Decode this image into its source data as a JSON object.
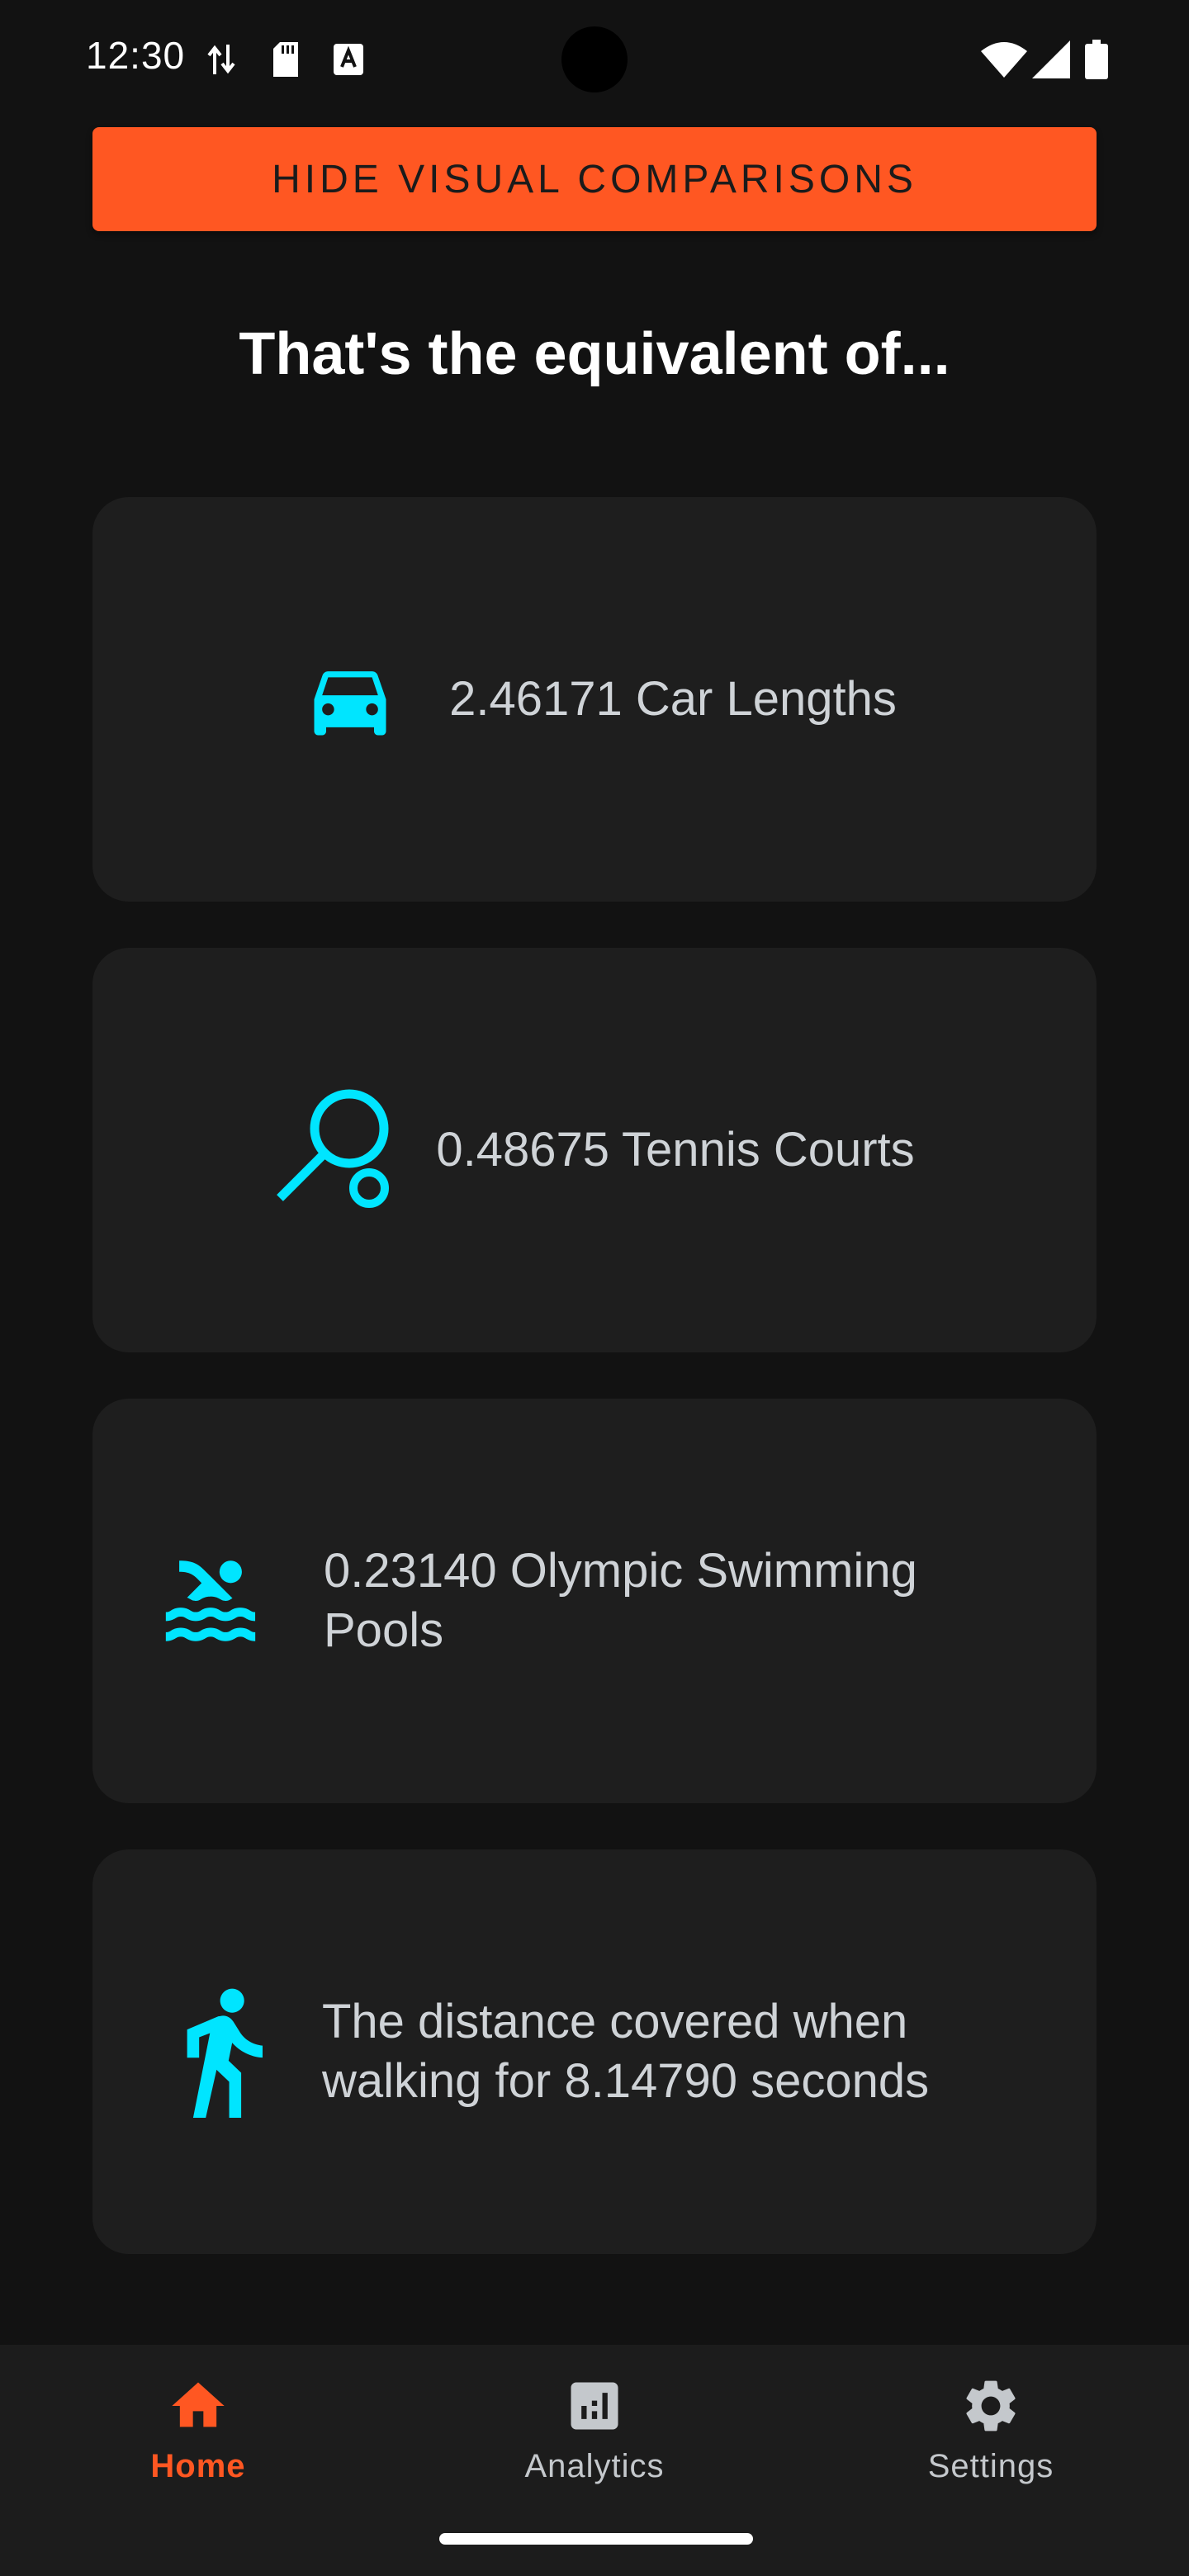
{
  "status_bar": {
    "time": "12:30",
    "icons": [
      "data-transfer-icon",
      "sd-card-icon",
      "keyboard-a-icon",
      "wifi-icon",
      "signal-icon",
      "battery-icon"
    ]
  },
  "actions": {
    "hide_comparisons_label": "HIDE VISUAL COMPARISONS"
  },
  "heading": "That's the equivalent of...",
  "comparisons": [
    {
      "icon": "car-icon",
      "text": "2.46171 Car Lengths"
    },
    {
      "icon": "tennis-icon",
      "text": "0.48675 Tennis Courts"
    },
    {
      "icon": "swimming-icon",
      "text": "0.23140 Olympic Swimming Pools"
    },
    {
      "icon": "walking-icon",
      "text": "The distance covered when walking for 8.14790 seconds"
    }
  ],
  "bottom_nav": {
    "items": [
      {
        "label": "Home",
        "icon": "home-icon",
        "active": true
      },
      {
        "label": "Analytics",
        "icon": "analytics-icon",
        "active": false
      },
      {
        "label": "Settings",
        "icon": "gear-icon",
        "active": false
      }
    ]
  },
  "colors": {
    "accent": "#ff5722",
    "icon_cyan": "#00e5ff",
    "background": "#121212",
    "card": "#1e1e1e"
  }
}
